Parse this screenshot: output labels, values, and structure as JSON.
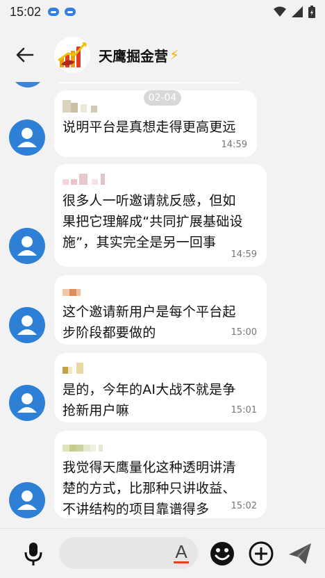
{
  "status_bar": {
    "time": "15:02",
    "notification_icons": [
      "app-notification-icon",
      "app-notification-icon"
    ],
    "right_icons": [
      "wifi-icon",
      "signal-icon",
      "battery-icon"
    ]
  },
  "header": {
    "title": "天鹰掘金营",
    "title_emoji": "⚡",
    "back_icon": "arrow-left-icon"
  },
  "date_chip": "02-04",
  "messages": [
    {
      "text": "说明平台是真想走得更高更远",
      "time": "14:59"
    },
    {
      "text": "很多人一听邀请就反感，但如\n果把它理解成“共同扩展基础设\n施”，其实完全是另一回事",
      "time": "14:59"
    },
    {
      "text": "这个邀请新用户是每个平台起\n步阶段都要做的",
      "time": "15:00"
    },
    {
      "text": "是的，今年的AI大战不就是争\n抢新用户嘛",
      "time": "15:01"
    },
    {
      "text": "我觉得天鹰量化这种透明讲清\n楚的方式，比那种只讲收益、\n不讲结构的项目靠谱得多",
      "time": "15:02"
    }
  ],
  "bottom_bar": {
    "icons": [
      "microphone-icon",
      "text-format-icon",
      "emoji-icon",
      "plus-icon",
      "send-icon"
    ]
  },
  "colors": {
    "background": "#f2f2f2",
    "bubble": "#ffffff",
    "avatar": "#2e7fd6",
    "format_underline": "#e2431e"
  }
}
